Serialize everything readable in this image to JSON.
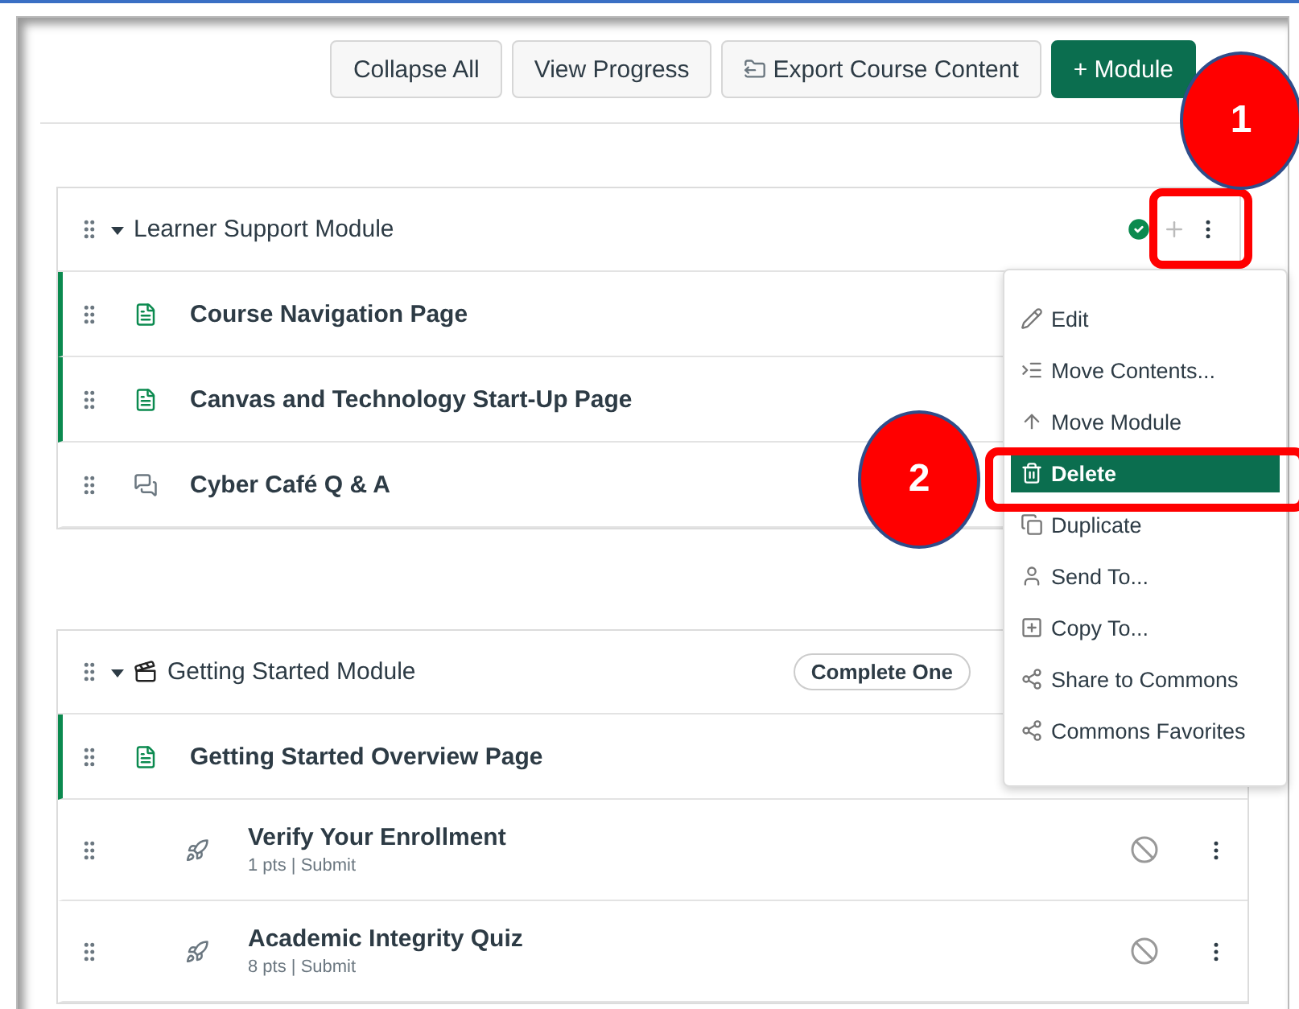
{
  "toolbar": [
    {
      "label": "Collapse All",
      "kind": "plain"
    },
    {
      "label": "View Progress",
      "kind": "plain"
    },
    {
      "label": "Export Course Content",
      "kind": "export"
    },
    {
      "label": "+ Module",
      "kind": "primary"
    }
  ],
  "modules": [
    {
      "title": "Learner Support Module",
      "expanded": true,
      "kind": "plain",
      "published": true,
      "items": [
        {
          "kind": "page",
          "title": "Course Navigation Page",
          "highlighted": true
        },
        {
          "kind": "page",
          "title": "Canvas and Technology Start-Up Page",
          "highlighted": true
        },
        {
          "kind": "discussion",
          "title": "Cyber Café Q & A",
          "highlighted": false
        }
      ]
    },
    {
      "title": "Getting Started Module",
      "expanded": true,
      "kind": "media",
      "requirement": "Complete One",
      "items": [
        {
          "kind": "page",
          "title": "Getting Started Overview Page",
          "highlighted": true
        },
        {
          "kind": "quiz",
          "title": "Verify Your Enrollment",
          "details": "1 pts | Submit",
          "highlighted": false,
          "published": false
        },
        {
          "kind": "quiz",
          "title": "Academic Integrity Quiz",
          "details": "8 pts | Submit",
          "highlighted": false,
          "published": false
        }
      ]
    }
  ],
  "menu": [
    {
      "kind": "edit",
      "label": "Edit",
      "selected": false
    },
    {
      "kind": "move-contents",
      "label": "Move Contents...",
      "selected": false
    },
    {
      "kind": "move",
      "label": "Move Module",
      "selected": false
    },
    {
      "kind": "delete",
      "label": "Delete",
      "selected": true
    },
    {
      "kind": "duplicate",
      "label": "Duplicate",
      "selected": false
    },
    {
      "kind": "send",
      "label": "Send To...",
      "selected": false
    },
    {
      "kind": "copy",
      "label": "Copy To...",
      "selected": false
    },
    {
      "kind": "share",
      "label": "Share to Commons",
      "selected": false
    },
    {
      "kind": "share",
      "label": "Commons Favorites",
      "selected": false
    }
  ],
  "callouts": [
    {
      "label": "1"
    },
    {
      "label": "2"
    }
  ]
}
